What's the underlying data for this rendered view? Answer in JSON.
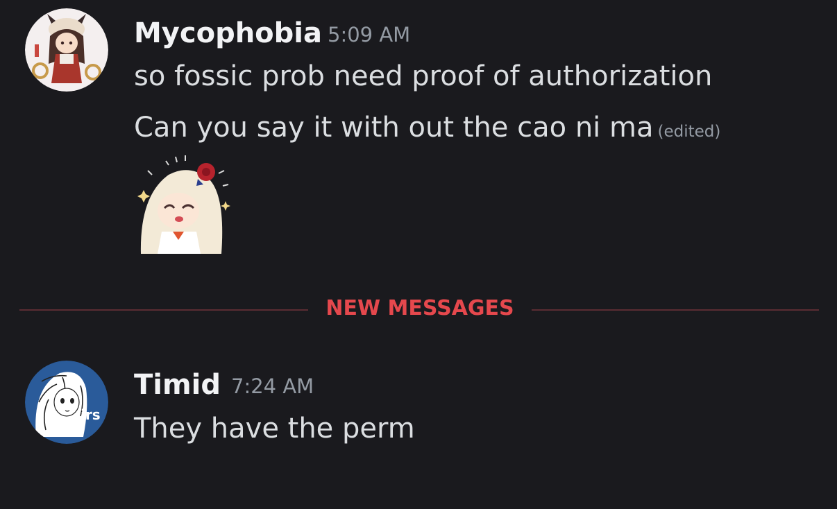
{
  "messages": [
    {
      "username": "Mycophobia",
      "timestamp": "5:09 AM",
      "lines": [
        "so fossic prob need proof of authorization",
        "Can you say it with out the cao ni ma"
      ],
      "edited_label": "(edited)",
      "has_sticker": true
    },
    {
      "username": "Timid",
      "timestamp": "7:24 AM",
      "lines": [
        "They have the perm"
      ],
      "avatar_badge": "irs"
    }
  ],
  "divider": {
    "label": "NEW MESSAGES"
  },
  "colors": {
    "background": "#1a1a1e",
    "username": "#f2f3f5",
    "message_text": "#dbdee1",
    "timestamp": "#949ba4",
    "new_messages": "#e5484d",
    "divider_line": "#5b2d33",
    "timid_avatar_bg": "#2a5b9a"
  },
  "icons": [
    "user-avatar-mycophobia",
    "user-avatar-timid",
    "anime-girl-sticker"
  ]
}
